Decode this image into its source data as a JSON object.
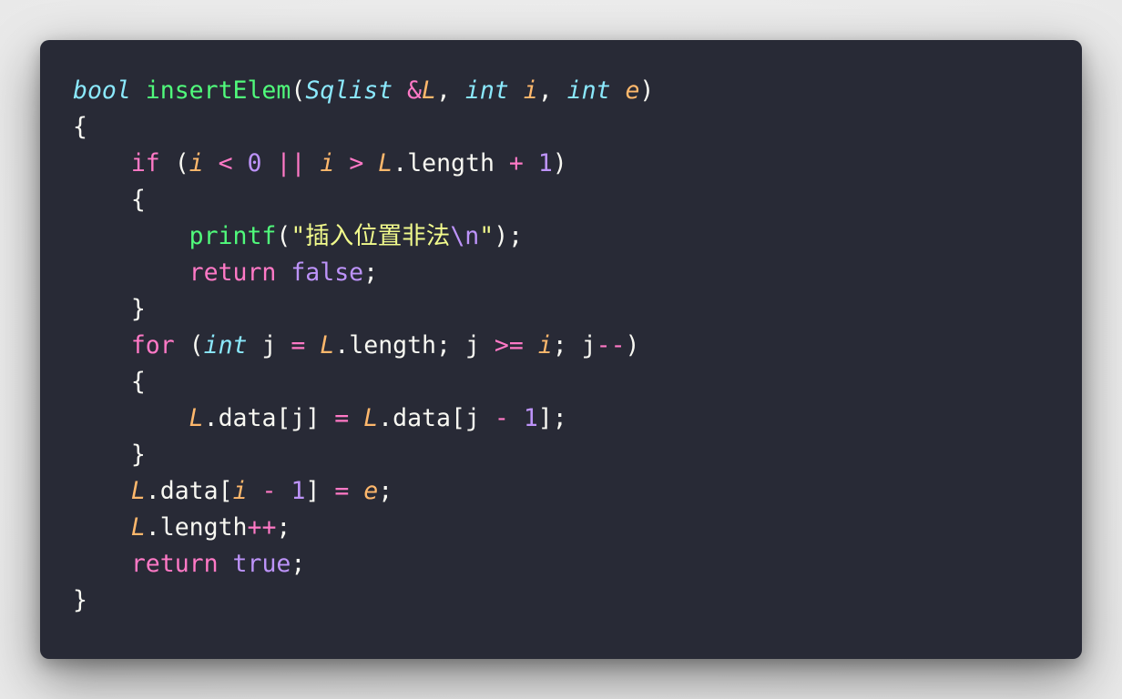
{
  "theme": {
    "background": "#282a36",
    "text": "#f8f8f2",
    "type_keyword": "#8be9fd",
    "control_keyword": "#ff79c6",
    "function": "#50fa7b",
    "parameter": "#ffb86c",
    "number": "#bd93f9",
    "string": "#f1fa8c"
  },
  "code": {
    "fn_type": "bool",
    "fn_name": "insertElem",
    "param1_type": "Sqlist",
    "param1_amp": "&",
    "param1_name": "L",
    "param2_type": "int",
    "param2_name": "i",
    "param3_type": "int",
    "param3_name": "e",
    "kw_if": "if",
    "kw_for": "for",
    "kw_return": "return",
    "kw_int": "int",
    "lit_false": "false",
    "lit_true": "true",
    "num_zero": "0",
    "num_one": "1",
    "member_length": "length",
    "member_data": "data",
    "var_j": "j",
    "printf_name": "printf",
    "printf_string_body": "\"插入位置非法",
    "printf_escape": "\\n",
    "printf_string_end": "\""
  }
}
